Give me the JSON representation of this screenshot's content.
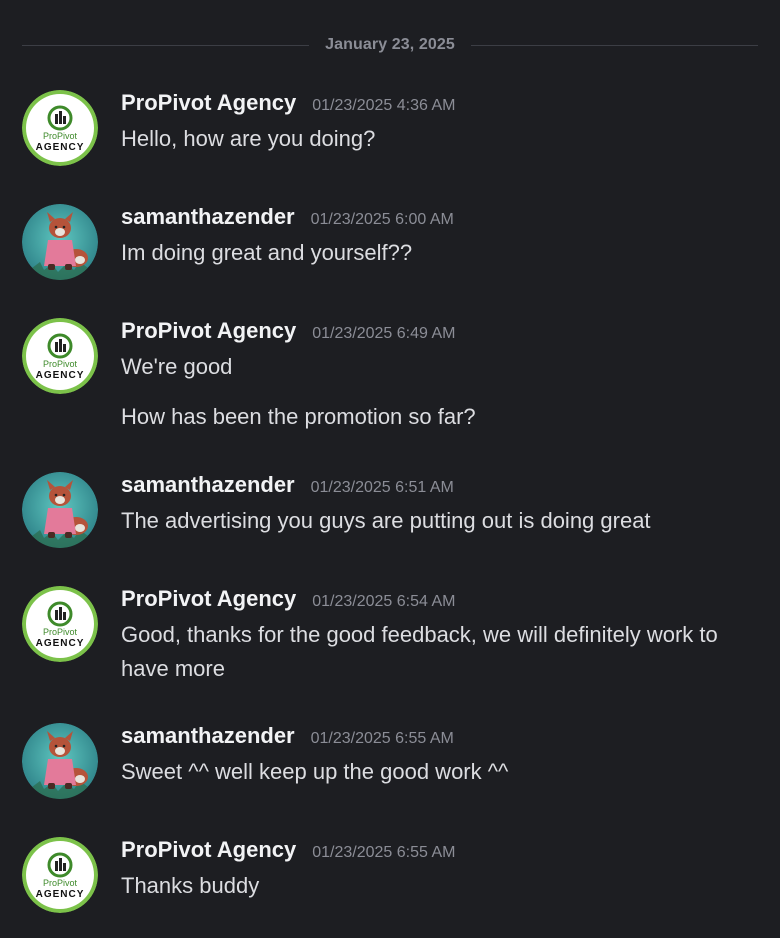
{
  "date_divider": "January 23, 2025",
  "users": {
    "agency": {
      "name": "ProPivot Agency",
      "avatar_icon": "propivot-agency-logo",
      "logo_text_top": "ProPivot",
      "logo_text_bottom": "AGENCY"
    },
    "samantha": {
      "name": "samanthazender",
      "avatar_icon": "fox-character-avatar"
    }
  },
  "messages": [
    {
      "author": "ProPivot Agency",
      "timestamp": "01/23/2025 4:36 AM",
      "lines": [
        "Hello, how are you doing?"
      ]
    },
    {
      "author": "samanthazender",
      "timestamp": "01/23/2025 6:00 AM",
      "lines": [
        "Im doing great and yourself??"
      ]
    },
    {
      "author": "ProPivot Agency",
      "timestamp": "01/23/2025 6:49 AM",
      "lines": [
        "We're good",
        "How has been the promotion so far?"
      ]
    },
    {
      "author": "samanthazender",
      "timestamp": "01/23/2025 6:51 AM",
      "lines": [
        "The advertising you guys are putting out is doing great"
      ]
    },
    {
      "author": "ProPivot Agency",
      "timestamp": "01/23/2025 6:54 AM",
      "lines": [
        "Good, thanks for the good feedback, we will definitely work to have more"
      ]
    },
    {
      "author": "samanthazender",
      "timestamp": "01/23/2025 6:55 AM",
      "lines": [
        "Sweet ^^ well keep up the good work ^^"
      ]
    },
    {
      "author": "ProPivot Agency",
      "timestamp": "01/23/2025 6:55 AM",
      "lines": [
        "Thanks buddy"
      ]
    }
  ],
  "colors": {
    "background": "#1d1e22",
    "username": "#f2f3f5",
    "timestamp": "#8b8d96",
    "text": "#dcdde1",
    "agency_ring": "#7cc24a",
    "agency_green": "#3e8a2a",
    "samantha_bg": "#3a9a9a"
  }
}
